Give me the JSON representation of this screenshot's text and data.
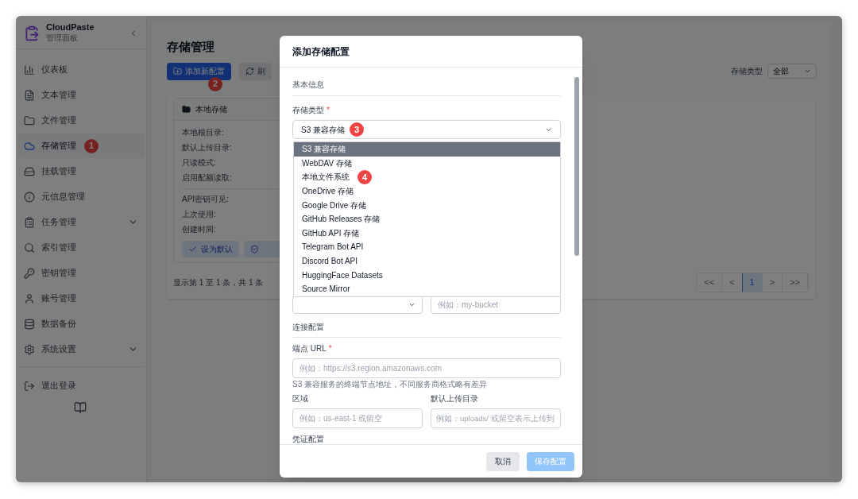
{
  "sidebar": {
    "app_name": "CloudPaste",
    "subtitle": "管理面板",
    "items": [
      {
        "label": "仪表板",
        "selected": false,
        "has_submenu": false
      },
      {
        "label": "文本管理",
        "selected": false,
        "has_submenu": false
      },
      {
        "label": "文件管理",
        "selected": false,
        "has_submenu": false
      },
      {
        "label": "存储管理",
        "selected": true,
        "has_submenu": false,
        "marker": "1"
      },
      {
        "label": "挂载管理",
        "selected": false,
        "has_submenu": false
      },
      {
        "label": "元信息管理",
        "selected": false,
        "has_submenu": false
      },
      {
        "label": "任务管理",
        "selected": false,
        "has_submenu": true
      },
      {
        "label": "索引管理",
        "selected": false,
        "has_submenu": false
      },
      {
        "label": "密钥管理",
        "selected": false,
        "has_submenu": false
      },
      {
        "label": "账号管理",
        "selected": false,
        "has_submenu": false
      },
      {
        "label": "数据备份",
        "selected": false,
        "has_submenu": false
      },
      {
        "label": "系统设置",
        "selected": false,
        "has_submenu": true
      }
    ],
    "logout": "退出登录"
  },
  "page": {
    "title": "存储管理",
    "add_button": {
      "label": "添加新配置",
      "marker": "2"
    },
    "refresh_button": "刷",
    "filter": {
      "label": "存储类型",
      "value": "全部"
    },
    "storage_card": {
      "title": "本地存储",
      "fields": [
        "本地根目录:",
        "默认上传目录:",
        "只读模式:",
        "启用配额读取:"
      ],
      "meta_fields": [
        "API密钥可见:",
        "上次使用:",
        "创建时间:"
      ],
      "default_button": "设为默认"
    },
    "summary": "显示第 1 至 1 条，共 1 条",
    "pagination": [
      {
        "label": "<<",
        "selected": false
      },
      {
        "label": "<",
        "selected": false
      },
      {
        "label": "1",
        "selected": true
      },
      {
        "label": ">",
        "selected": false
      },
      {
        "label": ">>",
        "selected": false
      }
    ]
  },
  "dialog": {
    "title": "添加存储配置",
    "section_basic": "基本信息",
    "type_label": "存储类型",
    "required_mark": "*",
    "type_value": "S3 兼容存储",
    "type_marker": "3",
    "options": [
      {
        "label": "S3 兼容存储",
        "selected": true
      },
      {
        "label": "WebDAV 存储",
        "selected": false
      },
      {
        "label": "本地文件系统",
        "selected": false,
        "marker": "4"
      },
      {
        "label": "OneDrive 存储",
        "selected": false
      },
      {
        "label": "Google Drive 存储",
        "selected": false
      },
      {
        "label": "GitHub Releases 存储",
        "selected": false
      },
      {
        "label": "GitHub API 存储",
        "selected": false
      },
      {
        "label": "Telegram Bot API",
        "selected": false
      },
      {
        "label": "Discord Bot API",
        "selected": false
      },
      {
        "label": "HuggingFace Datasets",
        "selected": false
      },
      {
        "label": "Source Mirror",
        "selected": false
      }
    ],
    "bucket_placeholder": "例如：my-bucket",
    "section_connection": "连接配置",
    "endpoint_label": "端点 URL",
    "endpoint_placeholder": "例如：https://s3.region.amazonaws.com",
    "endpoint_hint": "S3 兼容服务的终端节点地址，不同服务商格式略有差异",
    "region_label": "区域",
    "region_placeholder": "例如：us-east-1 或留空",
    "dir_label": "默认上传目录",
    "dir_placeholder": "例如：uploads/ 或留空表示上传到",
    "section_credentials": "凭证配置",
    "cancel": "取消",
    "save": {
      "label": "保存配置",
      "disabled": true
    }
  }
}
